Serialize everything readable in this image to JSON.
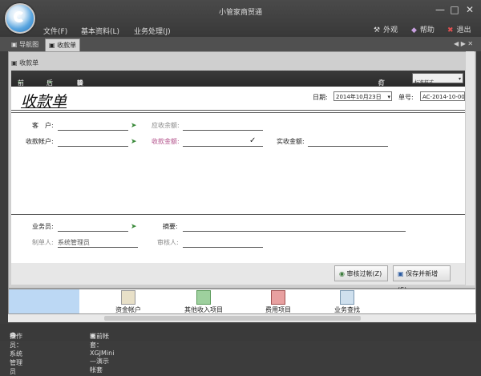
{
  "app": {
    "title": "小管家商贸通"
  },
  "menu": {
    "file": "文件(F)",
    "basic": "基本资料(L)",
    "business": "业务处理(J)"
  },
  "topright": {
    "appearance": "外观",
    "help": "帮助",
    "exit": "退出"
  },
  "tabs": {
    "nav": "导航图",
    "form": "收款单"
  },
  "doc_caption": "收款单",
  "toolbar": {
    "prev": "前单",
    "next": "后单",
    "ops": "操作(O)",
    "print": "打印(P)",
    "print_style": "标准样式"
  },
  "form": {
    "title": "收款单",
    "date_label": "日期:",
    "date_value": "2014年10月23日",
    "no_label": "单号:",
    "no_value": "AC-2014-10-000",
    "customer_label": "客　户:",
    "receivable_label": "应收余额:",
    "account_label": "收款帐户:",
    "amount_label": "收款金额:",
    "actual_label": "实收金额:",
    "salesman_label": "业务员:",
    "summary_label": "摘要:",
    "maker_label": "制单人:",
    "maker_value": "系统管理员",
    "auditor_label": "审核人:"
  },
  "buttons": {
    "audit": "审核过帐(Z)",
    "save_new": "保存并新增(S)"
  },
  "nav": {
    "items": [
      "资金帐户",
      "其他收入项目",
      "费用项目",
      "业务查找"
    ]
  },
  "status": {
    "operator": "操作员：系统管理员",
    "account": "当前帐套：XGJMini—演示帐套"
  }
}
